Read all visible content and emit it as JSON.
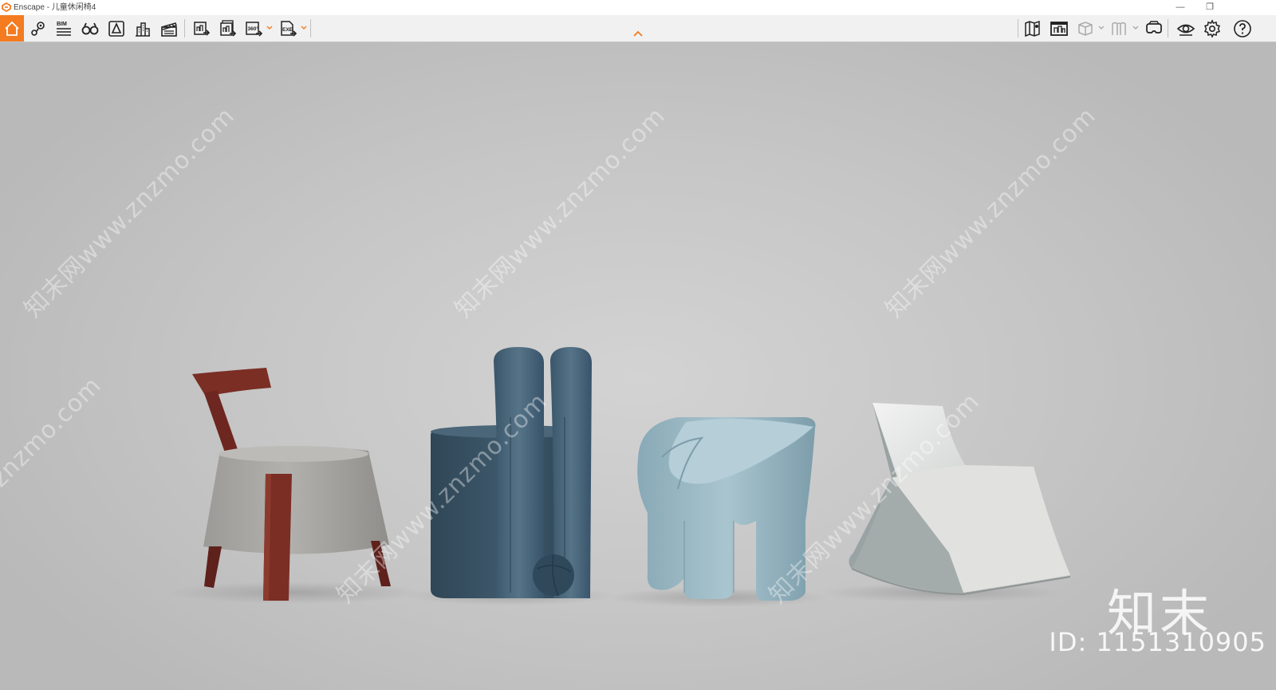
{
  "window": {
    "app_name": "Enscape",
    "title": "Enscape - 儿童休闲椅4",
    "minimize_label": "—",
    "restore_label": "❐"
  },
  "toolbar": {
    "accent_color": "#f47b20",
    "left_tools": [
      {
        "name": "home-icon"
      },
      {
        "name": "view-management-icon"
      },
      {
        "name": "bim-icon",
        "label": "BIM"
      },
      {
        "name": "binoculars-icon"
      },
      {
        "name": "asset-library-icon"
      },
      {
        "name": "buildings-icon"
      },
      {
        "name": "clapperboard-icon"
      }
    ],
    "export_tools": [
      {
        "name": "export-image-icon"
      },
      {
        "name": "batch-render-icon"
      },
      {
        "name": "export-panorama-icon",
        "label": "360°"
      },
      {
        "name": "export-exe-icon",
        "label": "EXE"
      }
    ],
    "right_tools": [
      {
        "name": "map-icon"
      },
      {
        "name": "render-window-icon"
      },
      {
        "name": "cube-icon"
      },
      {
        "name": "book-icon"
      },
      {
        "name": "vr-headset-icon"
      },
      {
        "name": "eye-icon"
      },
      {
        "name": "settings-gear-icon"
      },
      {
        "name": "help-icon"
      }
    ]
  },
  "viewport": {
    "watermark_text": "知末网www.znzmo.com",
    "watermark_short": "znzmo.com",
    "brand_logo": "知末",
    "brand_id": "ID: 1151310905",
    "chairs": [
      {
        "name": "wood-fabric-stool-chair",
        "colors": [
          "#7a2e24",
          "#a9a7a3"
        ]
      },
      {
        "name": "bunny-ear-armchair",
        "colors": [
          "#3e5a6c"
        ]
      },
      {
        "name": "elephant-chair",
        "colors": [
          "#8fb0bd"
        ]
      },
      {
        "name": "rocking-chair",
        "colors": [
          "#e4e5e3",
          "#a8afaf"
        ]
      }
    ]
  }
}
